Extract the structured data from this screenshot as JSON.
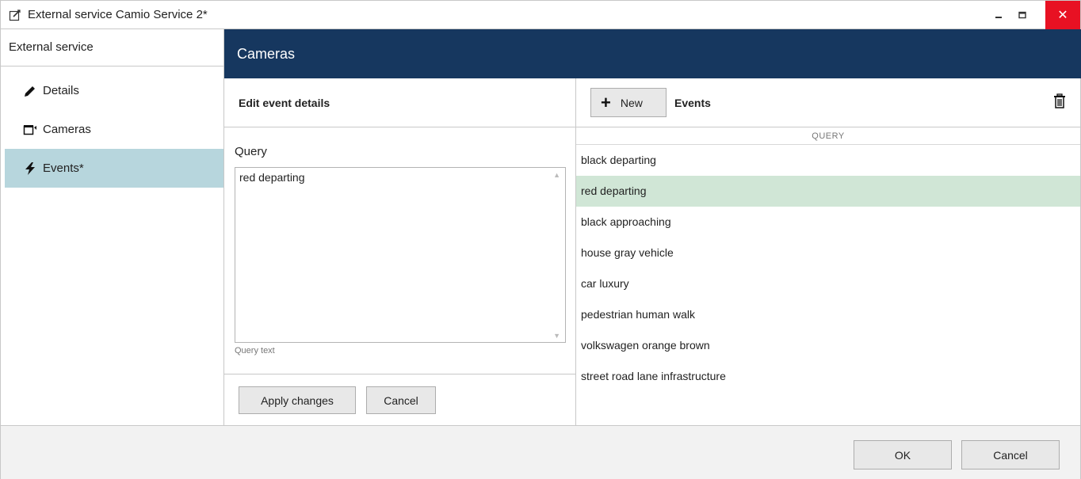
{
  "window": {
    "title": "External service Camio Service 2*",
    "minimize": "–",
    "maximize": "☐",
    "close": "✕"
  },
  "sidebar": {
    "header": "External service",
    "items": [
      {
        "label": "Details",
        "icon": "pencil-icon",
        "active": false
      },
      {
        "label": "Cameras",
        "icon": "camera-icon",
        "active": false
      },
      {
        "label": "Events*",
        "icon": "lightning-icon",
        "active": true
      }
    ]
  },
  "header": {
    "title": "Cameras"
  },
  "edit": {
    "title": "Edit event details",
    "query_label": "Query",
    "query_value": "red departing",
    "query_hint": "Query text",
    "apply_label": "Apply changes",
    "cancel_label": "Cancel"
  },
  "events": {
    "new_label": "New",
    "title": "Events",
    "column_header": "QUERY",
    "rows": [
      "black departing",
      "red departing",
      "black approaching",
      "house gray vehicle",
      "car luxury",
      "pedestrian human walk",
      "volkswagen orange brown",
      "street road lane infrastructure"
    ],
    "selected_index": 1
  },
  "footer": {
    "ok_label": "OK",
    "cancel_label": "Cancel"
  },
  "colors": {
    "header_bg": "#16375f",
    "active_sidebar": "#b7d6dd",
    "selected_row": "#d0e6d6",
    "close_btn": "#e81123"
  }
}
